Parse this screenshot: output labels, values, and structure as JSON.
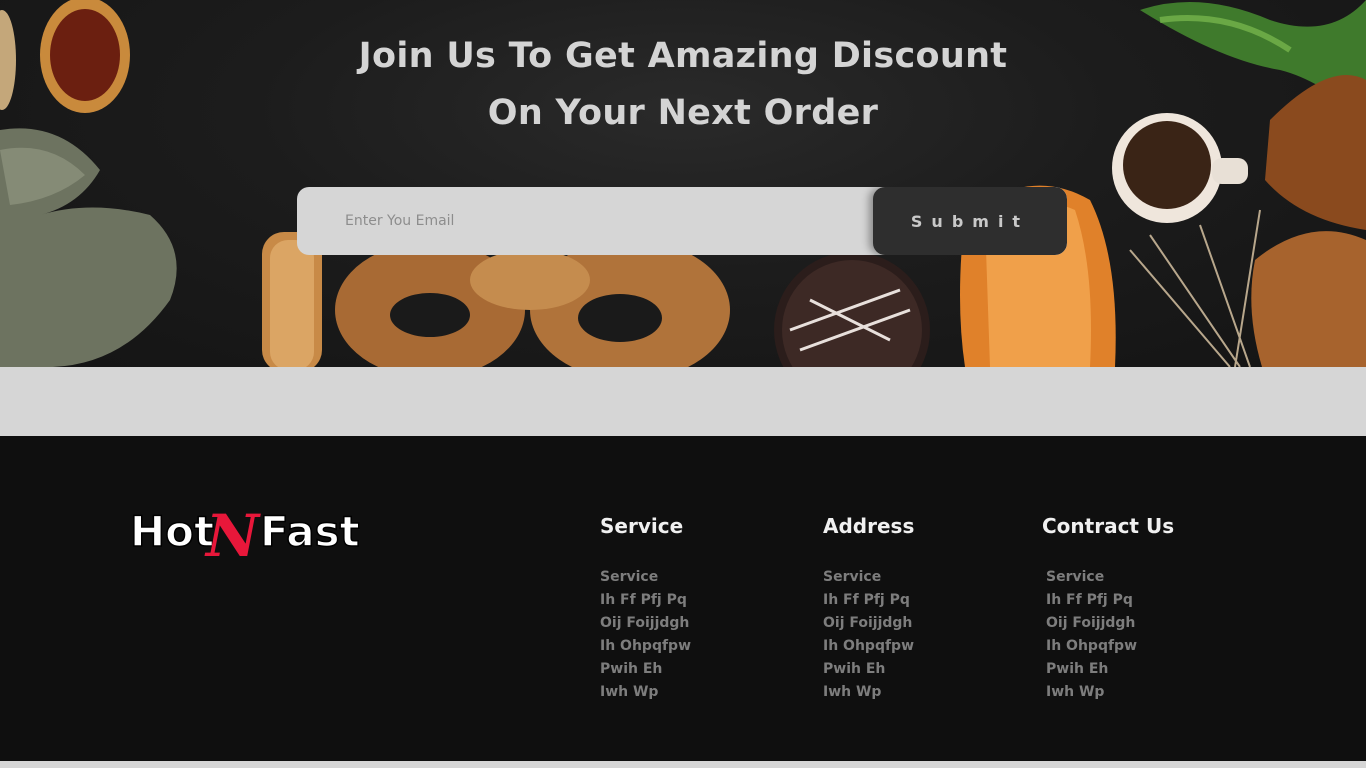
{
  "hero": {
    "headline_line1": "Join Us To Get Amazing Discount",
    "headline_line2": "On Your Next Order",
    "email_placeholder": "Enter You Email",
    "submit_label": "Submit"
  },
  "footer": {
    "logo_text": "HotNFast",
    "columns": [
      {
        "title": "Service",
        "items": [
          "Service",
          "Ih Ff Pfj Pq",
          "Oij Foijjdgh",
          "Ih Ohpqfpw",
          "Pwih Eh",
          "Iwh Wp"
        ]
      },
      {
        "title": "Address",
        "items": [
          "Service",
          "Ih Ff Pfj Pq",
          "Oij Foijjdgh",
          "Ih Ohpqfpw",
          "Pwih Eh",
          "Iwh Wp"
        ]
      },
      {
        "title": "Contract Us",
        "items": [
          "Service",
          "Ih Ff Pfj Pq",
          "Oij Foijjdgh",
          "Ih Ohpqfpw",
          "Pwih Eh",
          "Iwh Wp"
        ]
      }
    ]
  },
  "colors": {
    "hero_bg": "#1c1c1c",
    "input_bg": "#d6d6d6",
    "button_bg": "#2e2e2e",
    "footer_bg": "#0f0f0f",
    "logo_accent": "#e8173a"
  }
}
